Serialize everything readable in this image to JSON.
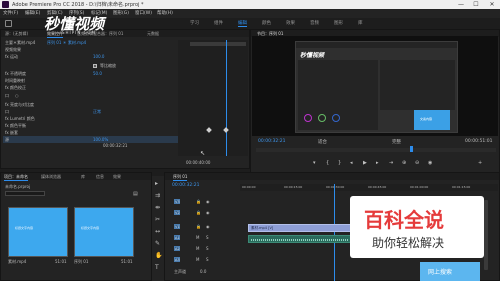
{
  "window": {
    "title": "Adobe Premiere Pro CC 2018 - D:\\归档\\未命名.prproj *",
    "controls": [
      "—",
      "☐",
      "✕"
    ]
  },
  "menu": [
    "文件(F)",
    "编辑(E)",
    "剪辑(C)",
    "序列(S)",
    "标记(M)",
    "图形(G)",
    "窗口(W)",
    "帮助(H)"
  ],
  "workspaces": [
    "编辑",
    "颜色",
    "效果",
    "音频",
    "图形",
    "库"
  ],
  "effect_controls": {
    "tabs": [
      "源：(无剪辑)",
      "效果控件",
      "音频剪辑混合器：序列 01",
      "元数据"
    ],
    "clip_header": "主要＊素材.mp4",
    "clip_link": "序列 01 ＊ 素材.mp4",
    "rows": [
      "视频效果",
      "fx 运动",
      "fx 不透明度",
      "时间重映射",
      "fx 颜色校正",
      "口",
      "○",
      "fx 亮度与对比度",
      "口",
      "fx Lumetri 颜色",
      "fx 颜色平衡",
      "fx 嵌套",
      "源"
    ],
    "checkbox_label": "等比缩放",
    "values": [
      "100.0",
      "50.0",
      "正常"
    ],
    "percent": "100.0%",
    "footer_time": "00:00:32:21",
    "footer_time_right": "00:00:40:00"
  },
  "program_monitor": {
    "tab": "节目：序列 01",
    "timecode_left": "00:00:32:21",
    "timecode_right": "00:00:51:01",
    "fit": "适合",
    "quality": "完整",
    "inner_blue_text": "文案内容"
  },
  "project": {
    "tabs": [
      "项目：未命名",
      "媒体浏览器",
      "库",
      "信息",
      "效果"
    ],
    "file": "未命名.prproj",
    "items": [
      {
        "name": "素材.mp4",
        "duration": "51:01",
        "caption": "标题文字内容"
      },
      {
        "name": "序列 01",
        "duration": "51:01",
        "caption": "标题文字内容"
      }
    ]
  },
  "timeline": {
    "tab": "序列 01",
    "timecode": "00:00:32:21",
    "ruler": [
      "00:00:00",
      "00:00:15:00",
      "00:00:30:00",
      "00:00:45:00",
      "00:01:00:00",
      "00:01:15:00"
    ],
    "video_tracks": [
      "V3",
      "V2",
      "V1"
    ],
    "audio_tracks": [
      "A1",
      "A2",
      "A3"
    ],
    "master": "主声道",
    "master_value": "0.0",
    "clip_name": "素材.mp4 [V]"
  },
  "watermark": {
    "title": "百科全说",
    "subtitle": "助你轻松解决",
    "corner_text": "网上搜索"
  },
  "logo": {
    "main": "秒懂视频",
    "sub": "SHIPIN.COM"
  },
  "colors": {
    "accent": "#2d8ceb",
    "thumb": "#3da8ee",
    "watermark_red": "#e53b3b"
  }
}
